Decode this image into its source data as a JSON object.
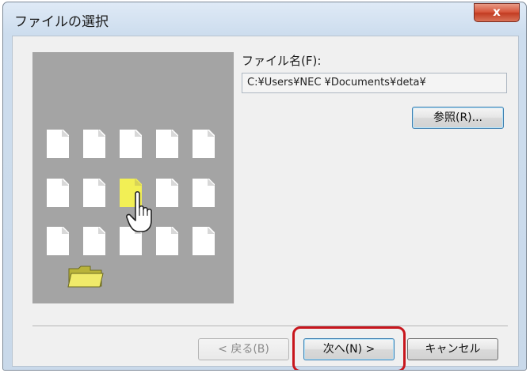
{
  "window": {
    "title": "ファイルの選択",
    "close_symbol": "x"
  },
  "form": {
    "file_name_label": "ファイル名(F):",
    "file_path_value": "C:¥Users¥NEC ¥Documents¥deta¥",
    "browse_label": "参照(R)..."
  },
  "footer": {
    "back_label": "< 戻る(B)",
    "next_label": "次へ(N) >",
    "cancel_label": "キャンセル"
  },
  "icons": {
    "documents": "document-icon",
    "selected_document": "document-icon-selected",
    "pointer": "hand-pointer-icon",
    "folder": "folder-icon"
  },
  "colors": {
    "selected_file": "#f2ef55",
    "highlight_ring": "#c8161d",
    "close_button": "#d6543a"
  }
}
